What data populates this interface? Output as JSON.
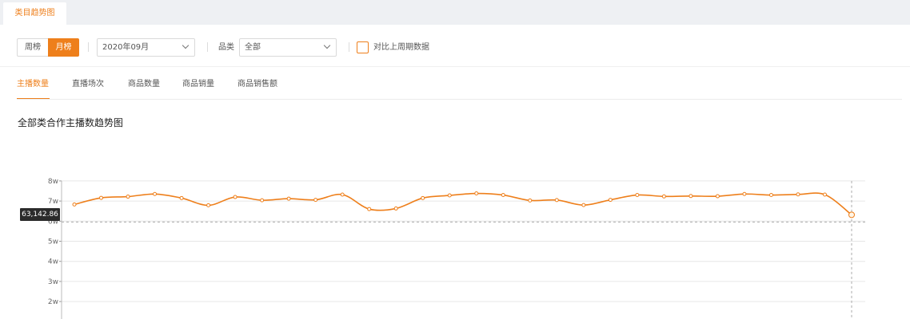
{
  "top_tabs": [
    "类目趋势图"
  ],
  "filters": {
    "period_week": "周榜",
    "period_month": "月榜",
    "month_value": "2020年09月",
    "category_label": "品类",
    "category_value": "全部",
    "compare_label": "对比上周期数据"
  },
  "metric_tabs": [
    "主播数量",
    "直播场次",
    "商品数量",
    "商品销量",
    "商品销售额"
  ],
  "chart_title": "全部类合作主播数趋势图",
  "tooltip_value": "63,142.86",
  "colors": {
    "accent": "#ee7f1b",
    "grid": "#e6e6e6",
    "tooltip_bg": "#2b2b2b"
  },
  "chart_data": {
    "type": "line",
    "title": "全部类合作主播数趋势图",
    "y_ticks": [
      "1w",
      "2w",
      "3w",
      "4w",
      "5w",
      "6w",
      "7w",
      "8w"
    ],
    "y_tick_values": [
      10000,
      20000,
      30000,
      40000,
      50000,
      60000,
      70000,
      80000
    ],
    "ylim": [
      0,
      80000
    ],
    "grid": true,
    "series": [
      {
        "values": [
          68300,
          71600,
          72200,
          73500,
          71500,
          67900,
          72000,
          70400,
          71200,
          70600,
          73200,
          66000,
          66300,
          71500,
          72800,
          73800,
          73000,
          70300,
          70500,
          68000,
          70600,
          73000,
          72300,
          72500,
          72400,
          73500,
          73000,
          73300,
          73200,
          63143
        ]
      }
    ],
    "highlighted_point_index": 29,
    "highlighted_value": 63142.86
  }
}
